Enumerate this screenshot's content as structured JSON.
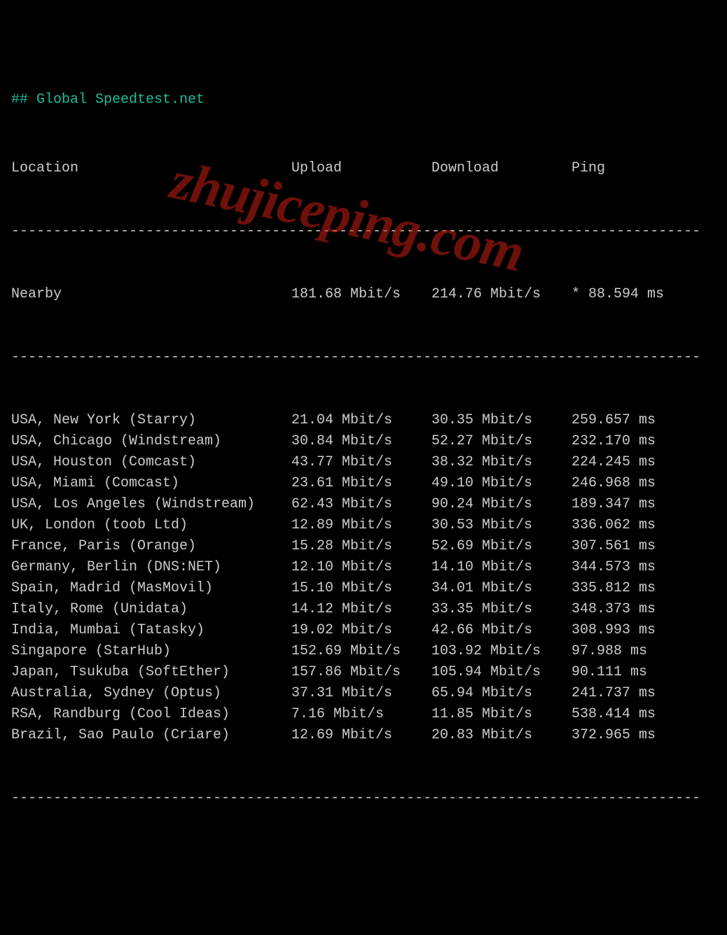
{
  "title": "## Global Speedtest.net",
  "columns": {
    "location": "Location",
    "upload": "Upload",
    "download": "Download",
    "ping": "Ping"
  },
  "dash_line": "----------------------------------------------------------------------------------",
  "nearby": {
    "location": "Nearby",
    "upload": "181.68 Mbit/s",
    "download": "214.76 Mbit/s",
    "ping": "* 88.594 ms"
  },
  "rows": [
    {
      "location": "USA, New York (Starry)",
      "upload": "21.04 Mbit/s",
      "download": "30.35 Mbit/s",
      "ping": "259.657 ms"
    },
    {
      "location": "USA, Chicago (Windstream)",
      "upload": "30.84 Mbit/s",
      "download": "52.27 Mbit/s",
      "ping": "232.170 ms"
    },
    {
      "location": "USA, Houston (Comcast)",
      "upload": "43.77 Mbit/s",
      "download": "38.32 Mbit/s",
      "ping": "224.245 ms"
    },
    {
      "location": "USA, Miami (Comcast)",
      "upload": "23.61 Mbit/s",
      "download": "49.10 Mbit/s",
      "ping": "246.968 ms"
    },
    {
      "location": "USA, Los Angeles (Windstream)",
      "upload": "62.43 Mbit/s",
      "download": "90.24 Mbit/s",
      "ping": "189.347 ms"
    },
    {
      "location": "UK, London (toob Ltd)",
      "upload": "12.89 Mbit/s",
      "download": "30.53 Mbit/s",
      "ping": "336.062 ms"
    },
    {
      "location": "France, Paris (Orange)",
      "upload": "15.28 Mbit/s",
      "download": "52.69 Mbit/s",
      "ping": "307.561 ms"
    },
    {
      "location": "Germany, Berlin (DNS:NET)",
      "upload": "12.10 Mbit/s",
      "download": "14.10 Mbit/s",
      "ping": "344.573 ms"
    },
    {
      "location": "Spain, Madrid (MasMovil)",
      "upload": "15.10 Mbit/s",
      "download": "34.01 Mbit/s",
      "ping": "335.812 ms"
    },
    {
      "location": "Italy, Rome (Unidata)",
      "upload": "14.12 Mbit/s",
      "download": "33.35 Mbit/s",
      "ping": "348.373 ms"
    },
    {
      "location": "India, Mumbai (Tatasky)",
      "upload": "19.02 Mbit/s",
      "download": "42.66 Mbit/s",
      "ping": "308.993 ms"
    },
    {
      "location": "Singapore (StarHub)",
      "upload": "152.69 Mbit/s",
      "download": "103.92 Mbit/s",
      "ping": "97.988 ms"
    },
    {
      "location": "Japan, Tsukuba (SoftEther)",
      "upload": "157.86 Mbit/s",
      "download": "105.94 Mbit/s",
      "ping": "90.111 ms"
    },
    {
      "location": "Australia, Sydney (Optus)",
      "upload": "37.31 Mbit/s",
      "download": "65.94 Mbit/s",
      "ping": "241.737 ms"
    },
    {
      "location": "RSA, Randburg (Cool Ideas)",
      "upload": "7.16 Mbit/s",
      "download": "11.85 Mbit/s",
      "ping": "538.414 ms"
    },
    {
      "location": "Brazil, Sao Paulo (Criare)",
      "upload": "12.69 Mbit/s",
      "download": "20.83 Mbit/s",
      "ping": "372.965 ms"
    }
  ],
  "watermark": "zhujiceping.com"
}
